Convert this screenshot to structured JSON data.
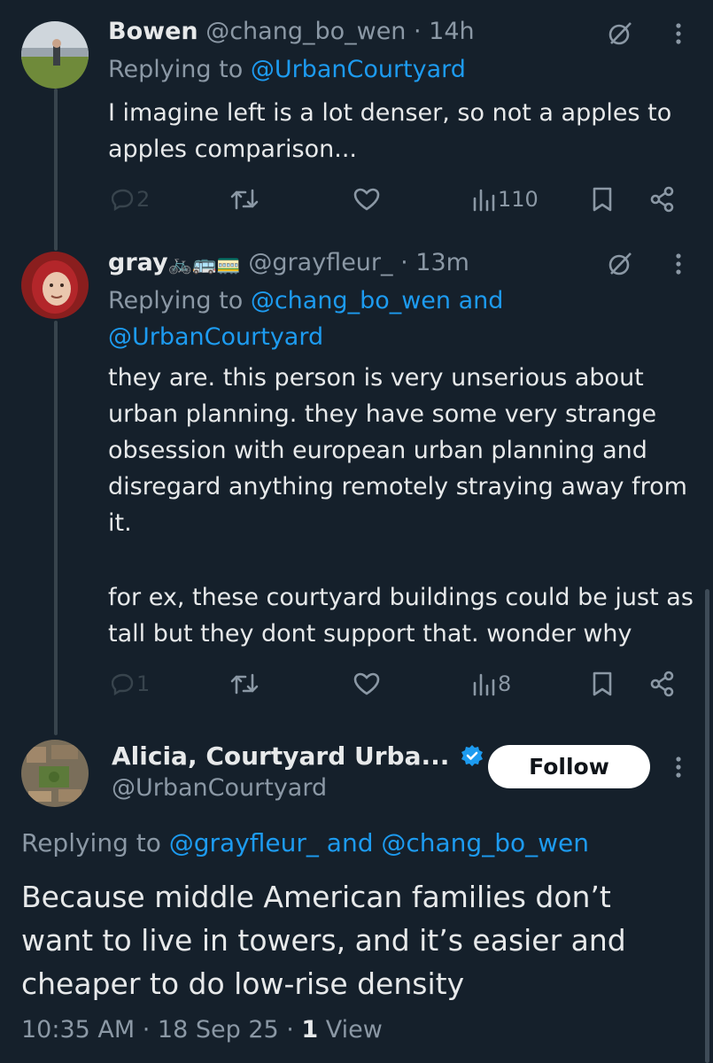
{
  "tweets": [
    {
      "name": "Bowen",
      "handle": "@chang_bo_wen",
      "time": "· 14h",
      "replying_prefix": "Replying to ",
      "replying_to": "@UrbanCourtyard",
      "text": "I imagine left is a lot denser, so not a apples to apples comparison...",
      "replies": "2",
      "views": "110"
    },
    {
      "name": "gray",
      "name_emoji": "🚲🚌🚃",
      "handle": "@grayfleur_",
      "time": "· 13m",
      "replying_prefix": "Replying to ",
      "replying_to_1": "@chang_bo_wen and",
      "replying_to_2": "@UrbanCourtyard",
      "text_p1": "they are. this person is very unserious about urban planning. they have some very strange obsession with european urban planning and disregard anything remotely straying away from it.",
      "text_p2": "for ex, these courtyard buildings could be just as tall but they dont support that. wonder why",
      "replies": "1",
      "views": "8"
    }
  ],
  "main_tweet": {
    "name": "Alicia, Courtyard Urba...",
    "handle": "@UrbanCourtyard",
    "follow_label": "Follow",
    "replying_prefix": "Replying to ",
    "replying_to": "@grayfleur_ and @chang_bo_wen",
    "text": "Because middle American families don’t want to live in towers, and it’s easier and cheaper to do low-rise density",
    "timestamp": "10:35 AM · 18 Sep 25 · ",
    "view_count": "1",
    "view_label": " View"
  },
  "icons": {
    "grok": "grok-icon",
    "more": "more-vertical-icon",
    "reply": "reply-icon",
    "retweet": "retweet-icon",
    "like": "heart-icon",
    "views": "views-chart-icon",
    "bookmark": "bookmark-icon",
    "share": "share-icon",
    "verified": "verified-badge-icon"
  },
  "colors": {
    "background": "#15202b",
    "text": "#e7e9ea",
    "muted": "#8b98a5",
    "link": "#1d9bf0",
    "thread_line": "#38444d"
  }
}
